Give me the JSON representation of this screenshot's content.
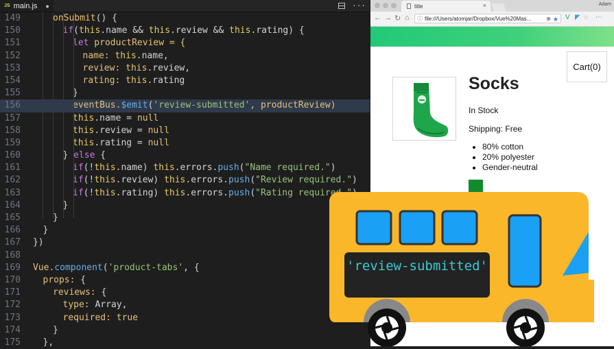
{
  "editor": {
    "tab_badge": "JS",
    "file_name": "main.js",
    "dirty_marker": "●",
    "more_icon": "···",
    "lines": [
      {
        "n": "149",
        "i": 2,
        "tokens": [
          [
            "onSubmit",
            "t-fny"
          ],
          [
            "() {",
            ""
          ]
        ]
      },
      {
        "n": "150",
        "i": 3,
        "tokens": [
          [
            "if",
            "t-key"
          ],
          [
            "(",
            ""
          ],
          [
            "this",
            "t-this"
          ],
          [
            ".name && ",
            ""
          ],
          [
            "this",
            "t-this"
          ],
          [
            ".review && ",
            ""
          ],
          [
            "this",
            "t-this"
          ],
          [
            ".rating) {",
            ""
          ]
        ]
      },
      {
        "n": "151",
        "i": 4,
        "tokens": [
          [
            "let",
            "t-key"
          ],
          [
            " productReview = {",
            "t-kwy"
          ]
        ]
      },
      {
        "n": "152",
        "i": 5,
        "tokens": [
          [
            "name: ",
            "t-kwy"
          ],
          [
            "this",
            "t-this"
          ],
          [
            ".name,",
            ""
          ]
        ]
      },
      {
        "n": "153",
        "i": 5,
        "tokens": [
          [
            "review: ",
            "t-kwy"
          ],
          [
            "this",
            "t-this"
          ],
          [
            ".review,",
            ""
          ]
        ]
      },
      {
        "n": "154",
        "i": 5,
        "tokens": [
          [
            "rating: ",
            "t-kwy"
          ],
          [
            "this",
            "t-this"
          ],
          [
            ".rating",
            ""
          ]
        ]
      },
      {
        "n": "155",
        "i": 4,
        "tokens": [
          [
            "}",
            ""
          ]
        ]
      },
      {
        "n": "156",
        "i": 4,
        "hl": true,
        "tokens": [
          [
            "eventBus.",
            "t-kwy"
          ],
          [
            "$emit",
            "t-fn"
          ],
          [
            "(",
            ""
          ],
          [
            "'review-submitted'",
            "t-str"
          ],
          [
            ", productReview)",
            "t-kwy"
          ]
        ]
      },
      {
        "n": "157",
        "i": 4,
        "tokens": [
          [
            "this",
            "t-this"
          ],
          [
            ".name = ",
            ""
          ],
          [
            "null",
            "t-kwy"
          ]
        ]
      },
      {
        "n": "158",
        "i": 4,
        "tokens": [
          [
            "this",
            "t-this"
          ],
          [
            ".review = ",
            ""
          ],
          [
            "null",
            "t-kwy"
          ]
        ]
      },
      {
        "n": "159",
        "i": 4,
        "tokens": [
          [
            "this",
            "t-this"
          ],
          [
            ".rating = ",
            ""
          ],
          [
            "null",
            "t-kwy"
          ]
        ]
      },
      {
        "n": "160",
        "i": 3,
        "tokens": [
          [
            "} ",
            ""
          ],
          [
            "else",
            "t-key"
          ],
          [
            " {",
            ""
          ]
        ]
      },
      {
        "n": "161",
        "i": 4,
        "tokens": [
          [
            "if",
            "t-key"
          ],
          [
            "(!",
            ""
          ],
          [
            "this",
            "t-this"
          ],
          [
            ".name) ",
            ""
          ],
          [
            "this",
            "t-this"
          ],
          [
            ".errors.",
            ""
          ],
          [
            "push",
            "t-fn"
          ],
          [
            "(",
            ""
          ],
          [
            "\"Name required.\"",
            "t-str"
          ],
          [
            ")",
            ""
          ]
        ]
      },
      {
        "n": "162",
        "i": 4,
        "tokens": [
          [
            "if",
            "t-key"
          ],
          [
            "(!",
            ""
          ],
          [
            "this",
            "t-this"
          ],
          [
            ".review) ",
            ""
          ],
          [
            "this",
            "t-this"
          ],
          [
            ".errors.",
            ""
          ],
          [
            "push",
            "t-fn"
          ],
          [
            "(",
            ""
          ],
          [
            "\"Review required.\"",
            "t-str"
          ],
          [
            ")",
            ""
          ]
        ]
      },
      {
        "n": "163",
        "i": 4,
        "tokens": [
          [
            "if",
            "t-key"
          ],
          [
            "(!",
            ""
          ],
          [
            "this",
            "t-this"
          ],
          [
            ".rating) ",
            ""
          ],
          [
            "this",
            "t-this"
          ],
          [
            ".errors.",
            ""
          ],
          [
            "push",
            "t-fn"
          ],
          [
            "(",
            ""
          ],
          [
            "\"Rating required.\"",
            "t-str"
          ],
          [
            ")",
            ""
          ]
        ]
      },
      {
        "n": "164",
        "i": 3,
        "tokens": [
          [
            "}",
            ""
          ]
        ]
      },
      {
        "n": "165",
        "i": 2,
        "tokens": [
          [
            "}",
            ""
          ]
        ]
      },
      {
        "n": "166",
        "i": 1,
        "tokens": [
          [
            "}",
            ""
          ]
        ]
      },
      {
        "n": "167",
        "i": 0,
        "tokens": [
          [
            "})",
            ""
          ]
        ]
      },
      {
        "n": "168",
        "i": 0,
        "tokens": []
      },
      {
        "n": "169",
        "i": 0,
        "tokens": [
          [
            "Vue.",
            "t-kwy"
          ],
          [
            "component",
            "t-fn"
          ],
          [
            "(",
            ""
          ],
          [
            "'product-tabs'",
            "t-str"
          ],
          [
            ", {",
            ""
          ]
        ]
      },
      {
        "n": "170",
        "i": 1,
        "tokens": [
          [
            "props: ",
            "t-kwy"
          ],
          [
            "{",
            ""
          ]
        ]
      },
      {
        "n": "171",
        "i": 2,
        "tokens": [
          [
            "reviews: ",
            "t-kwy"
          ],
          [
            "{",
            ""
          ]
        ]
      },
      {
        "n": "172",
        "i": 3,
        "tokens": [
          [
            "type: ",
            "t-kwy"
          ],
          [
            "Array",
            ""
          ],
          [
            ",",
            ""
          ]
        ]
      },
      {
        "n": "173",
        "i": 3,
        "tokens": [
          [
            "required: ",
            "t-kwy"
          ],
          [
            "true",
            "t-kwy"
          ]
        ]
      },
      {
        "n": "174",
        "i": 2,
        "tokens": [
          [
            "}",
            ""
          ]
        ]
      },
      {
        "n": "175",
        "i": 1,
        "tokens": [
          [
            "},",
            ""
          ]
        ]
      }
    ]
  },
  "browser": {
    "tab_title": "title",
    "tab_close": "×",
    "profile_name": "Adam",
    "address": "file:///Users/atomjar/Dropbox/Vue%20Mas...",
    "nav": {
      "back": "←",
      "forward": "→",
      "reload": "↻",
      "home": "⌂"
    },
    "cart_label": "Cart(0)",
    "product": {
      "title": "Socks",
      "stock": "In Stock",
      "shipping": "Shipping: Free",
      "details": [
        "80% cotton",
        "20% polyester",
        "Gender-neutral"
      ],
      "swatch_color": "#128a2e"
    },
    "accent_gradient": [
      "#22c978",
      "#7fe08a"
    ]
  },
  "overlay": {
    "bus_sign": "'review-submitted'",
    "bus_color": "#fbb72a",
    "window_color": "#1aa0f5"
  }
}
